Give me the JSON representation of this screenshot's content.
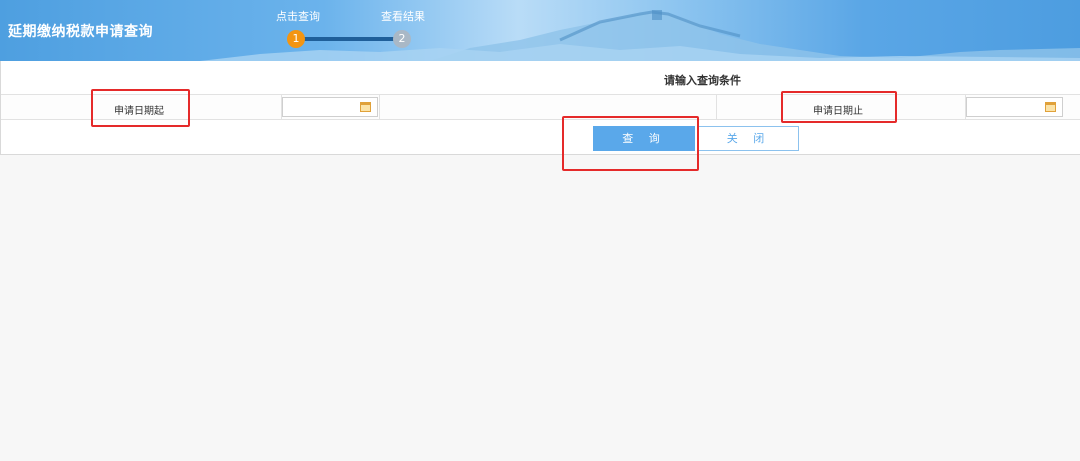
{
  "header": {
    "title": "延期缴纳税款申请查询",
    "steps": [
      {
        "label": "点击查询",
        "number": "1",
        "state": "active"
      },
      {
        "label": "查看结果",
        "number": "2",
        "state": "inactive"
      }
    ]
  },
  "form": {
    "section_title": "请输入查询条件",
    "start_date_label": "申请日期起",
    "start_date_value": "",
    "end_date_label": "申请日期止",
    "end_date_value": ""
  },
  "buttons": {
    "query_label": "查 询",
    "close_label": "关 闭"
  },
  "colors": {
    "accent": "#5aa8ea",
    "step_active": "#f39512",
    "step_inactive": "#a9b8c6",
    "highlight": "#e52a2a"
  }
}
